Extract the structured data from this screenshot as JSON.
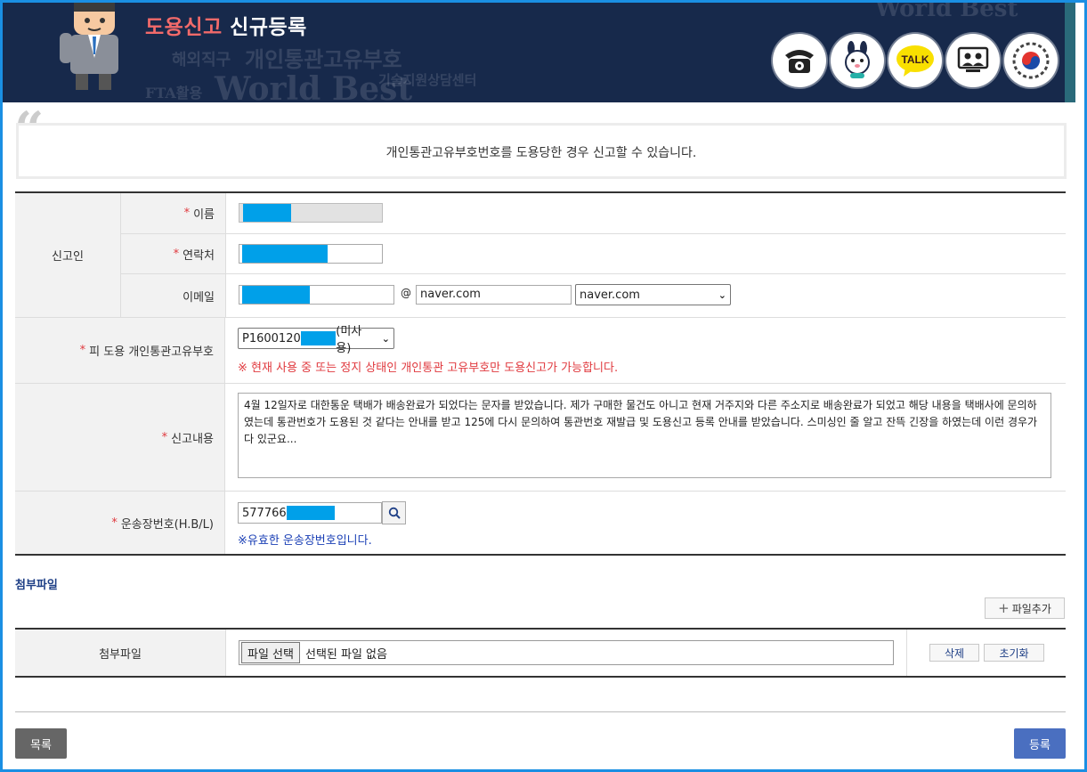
{
  "header": {
    "title_red": "도용신고",
    "title_white": "신규등록",
    "background_words": [
      "World Best",
      "개인통관고유부호",
      "해외직구",
      "FTA활용",
      "World Best",
      "기술지원상담센터"
    ],
    "icons": [
      "phone-icon",
      "mascot-rabbit-icon",
      "kakaotalk-icon",
      "video-consult-icon",
      "government-emblem-icon"
    ],
    "talk_label": "TALK"
  },
  "notice": {
    "text": "개인통관고유부호번호를 도용당한 경우 신고할 수 있습니다."
  },
  "form": {
    "reporter_group": "신고인",
    "required_mark": "*",
    "name_label": "이름",
    "contact_label": "연락처",
    "email_label": "이메일",
    "email_at": "@",
    "email_domain_value": "naver.com",
    "email_domain_select": "naver.com",
    "victim_label": "피 도용 개인통관고유부호",
    "victim_select_prefix": "P1600120",
    "victim_select_suffix": "(미사용)",
    "victim_warning": "※ 현재 사용 중 또는 정지 상태인 개인통관 고유부호만 도용신고가 가능합니다.",
    "content_label": "신고내용",
    "content_text": "4월 12일자로 대한통운 택배가 배송완료가 되었다는 문자를 받았습니다. 제가 구매한 물건도 아니고 현재 거주지와 다른 주소지로 배송완료가 되었고 해당 내용을 택배사에 문의하였는데 통관번호가 도용된 것 같다는 안내를 받고 125에 다시 문의하여 통관번호 재발급 및 도용신고 등록 안내를 받았습니다. 스미싱인 줄 알고 잔뜩 긴장을 하였는데 이런 경우가 다 있군요...",
    "waybill_label": "운송장번호(H.B/L)",
    "waybill_value": "577766",
    "waybill_ok": "※유효한 운송장번호입니다."
  },
  "attachments": {
    "section_title": "첨부파일",
    "add_button": "파일추가",
    "row_label": "첨부파일",
    "choose_button": "파일 선택",
    "no_file": "선택된 파일 없음",
    "delete_button": "삭제",
    "reset_button": "초기화"
  },
  "footer": {
    "list_button": "목록",
    "submit_button": "등록"
  },
  "colors": {
    "header_bg": "#17294b",
    "title_accent": "#f26a6a",
    "required": "#e0393e",
    "mask": "#00a0e9",
    "link_blue": "#1e3f86",
    "submit_bg": "#4a6fc0"
  }
}
